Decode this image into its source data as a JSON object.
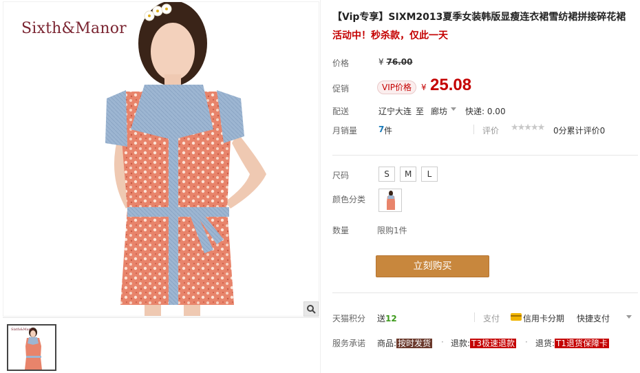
{
  "gallery": {
    "brand": "Sixth&Manor",
    "thumb_brand": "Sixth&Manor",
    "zoom_icon": "magnifier-icon"
  },
  "product": {
    "title": "【Vip专享】SIXM2013夏季女装韩版显瘦连衣裙雪纺裙拼接碎花裙",
    "promo_line": "活动中！秒杀款，仅此一天"
  },
  "price": {
    "label": "价格",
    "currency": "¥",
    "original": "76.00"
  },
  "promo_price": {
    "label": "促销",
    "badge": "VIP价格",
    "currency": "¥",
    "value": "25.08"
  },
  "shipping": {
    "label": "配送",
    "from": "辽宁大连",
    "to_word": "至",
    "destination": "廊坊",
    "fee": "快递: 0.00"
  },
  "sales": {
    "label": "月销量",
    "count": "7",
    "unit": "件",
    "rating_label": "评价",
    "stars": "★★★★★",
    "rating_text": "0分累计评价0"
  },
  "options": {
    "size_label": "尺码",
    "sizes": [
      "S",
      "M",
      "L"
    ],
    "color_label": "颜色分类",
    "quantity_label": "数量",
    "quantity_limit": "限购1件"
  },
  "buy": {
    "label": "立刻购买"
  },
  "points": {
    "label": "天猫积分",
    "prefix": "送",
    "value": "12"
  },
  "payment": {
    "label": "支付",
    "card": "信用卡分期",
    "quick": "快捷支付"
  },
  "service": {
    "label": "服务承诺",
    "goods_prefix": "商品:",
    "goods_tag": "按时发货",
    "refund_prefix": "退款:",
    "refund_tag": "T3极速退款",
    "return_prefix": "退货:",
    "return_tag": "T1退货保障卡"
  },
  "colors": {
    "price_red": "#c40000",
    "buy_button": "#c8873d",
    "brand": "#7a2431",
    "sales_blue": "#1a7ab8",
    "points_green": "#3d9a1c"
  }
}
